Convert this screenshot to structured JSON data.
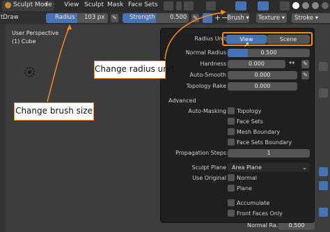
{
  "header": {
    "mode": "Sculpt Mode",
    "menus": [
      "View",
      "Sculpt",
      "Mask",
      "Face Sets"
    ]
  },
  "toolbar": {
    "tool_name": "tDraw",
    "radius": {
      "label": "Radius",
      "value": "103 px"
    },
    "strength": {
      "label": "Strength",
      "value": "0.500"
    },
    "brush_label": "Brush",
    "texture_label": "Texture",
    "stroke_label": "Stroke"
  },
  "viewport": {
    "view_name": "User Perspective",
    "object_name": "(1) Cube",
    "bottom_label": "Normal Ra...",
    "bottom_value": "0.500"
  },
  "panel": {
    "radius_unit_label": "Radius Unit",
    "radius_unit_options": [
      "View",
      "Scene"
    ],
    "radius_unit_selected": "View",
    "normal_radius": {
      "label": "Normal Radius",
      "value": "0.500",
      "fraction": 0.5
    },
    "hardness": {
      "label": "Hardness",
      "value": "0.000"
    },
    "auto_smooth": {
      "label": "Auto-Smooth",
      "value": "0.000"
    },
    "topology_rake": {
      "label": "Topology Rake",
      "value": "0.000"
    },
    "advanced_label": "Advanced",
    "auto_masking_label": "Auto-Masking",
    "auto_masking_options": [
      "Topology",
      "Face Sets",
      "Mesh Boundary",
      "Face Sets Boundary"
    ],
    "propagation_steps": {
      "label": "Propagation Steps",
      "value": "1"
    },
    "sculpt_plane": {
      "label": "Sculpt Plane",
      "value": "Area Plane"
    },
    "use_original_label": "Use Original",
    "use_original_options": [
      "Normal",
      "Plane"
    ],
    "accumulate_label": "Accumulate",
    "front_faces_label": "Front Faces Only"
  },
  "callouts": {
    "radius_unit": "Change radius unit",
    "brush_size": "Change brush size"
  },
  "colors": {
    "accent": "#4772b3",
    "callout_border": "#ff8c1a",
    "panel_bg": "#1f1f1f",
    "viewport_bg": "#3d3d3d"
  }
}
